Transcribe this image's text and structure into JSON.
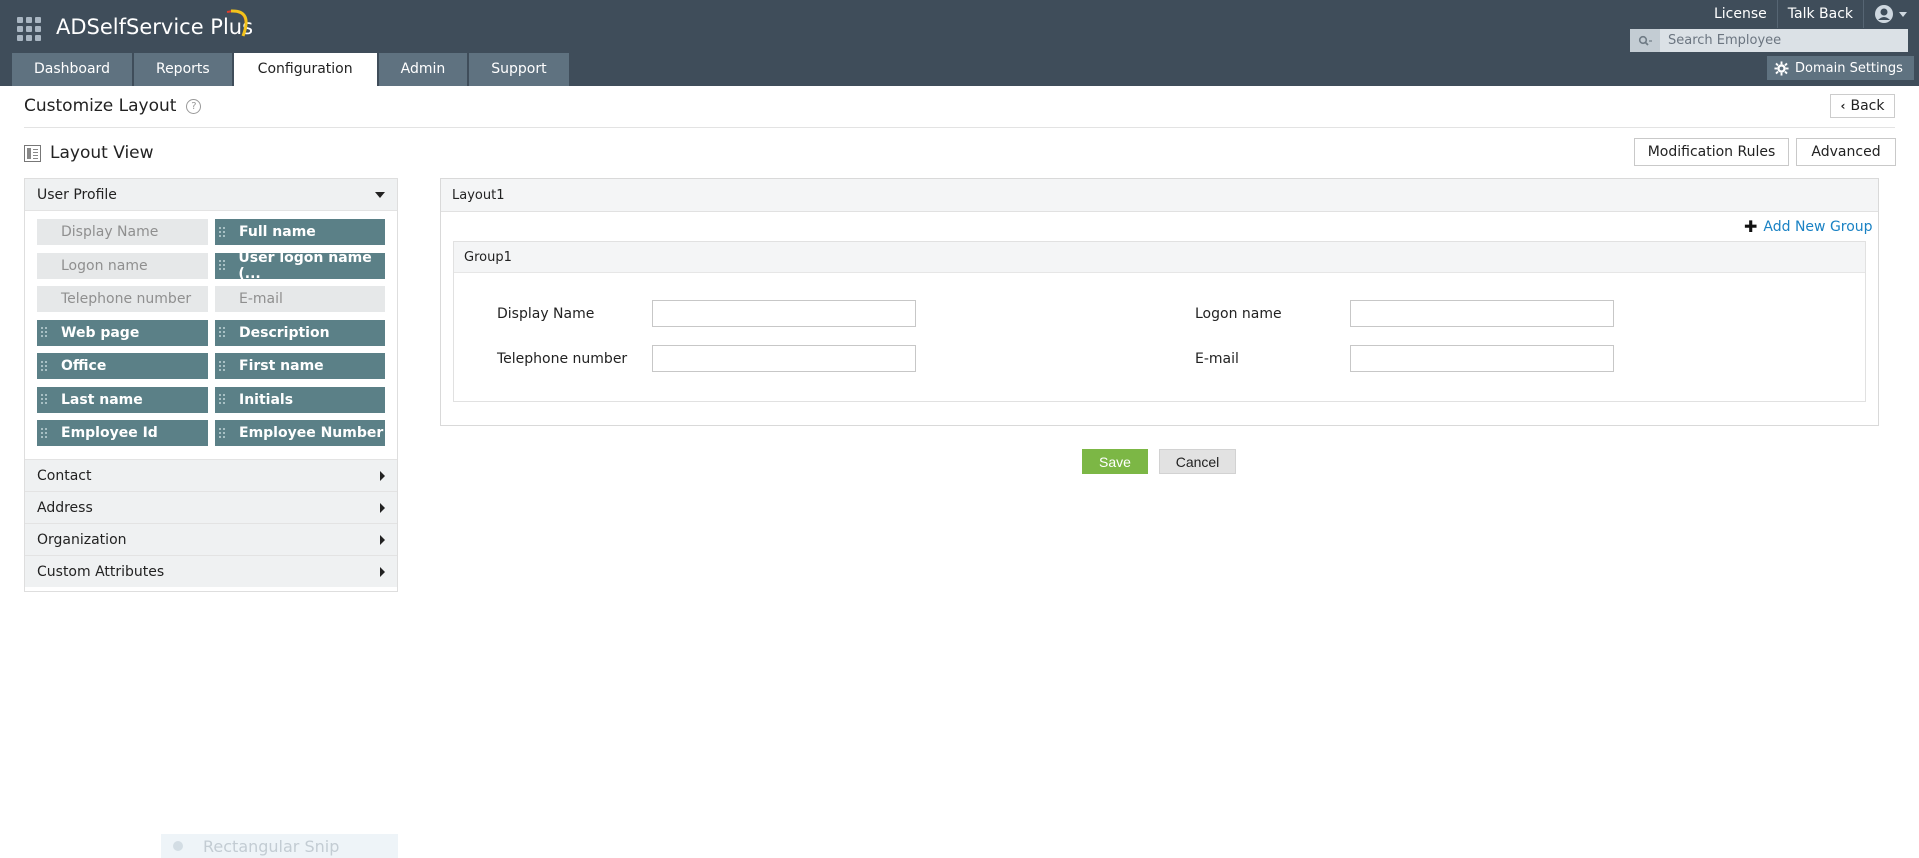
{
  "header": {
    "brand": "ADSelfService Plus",
    "links": [
      "License",
      "Talk Back"
    ],
    "search_placeholder": "Search Employee",
    "domain_settings": "Domain Settings"
  },
  "tabs": [
    {
      "label": "Dashboard",
      "active": false
    },
    {
      "label": "Reports",
      "active": false
    },
    {
      "label": "Configuration",
      "active": true
    },
    {
      "label": "Admin",
      "active": false
    },
    {
      "label": "Support",
      "active": false
    }
  ],
  "page": {
    "title": "Customize Layout",
    "help": "?",
    "back": "Back",
    "layout_view": "Layout View",
    "modification_rules": "Modification Rules",
    "advanced": "Advanced"
  },
  "panel": {
    "user_profile": "User Profile",
    "fields": [
      {
        "label": "Display Name",
        "state": "used"
      },
      {
        "label": "Full name",
        "state": "available"
      },
      {
        "label": "Logon name",
        "state": "used"
      },
      {
        "label": "User logon name (...",
        "state": "available"
      },
      {
        "label": "Telephone number",
        "state": "used"
      },
      {
        "label": "E-mail",
        "state": "used"
      },
      {
        "label": "Web page",
        "state": "available"
      },
      {
        "label": "Description",
        "state": "available"
      },
      {
        "label": "Office",
        "state": "available"
      },
      {
        "label": "First name",
        "state": "available"
      },
      {
        "label": "Last name",
        "state": "available"
      },
      {
        "label": "Initials",
        "state": "available"
      },
      {
        "label": "Employee Id",
        "state": "available"
      },
      {
        "label": "Employee Number",
        "state": "available"
      }
    ],
    "sections": [
      "Contact",
      "Address",
      "Organization",
      "Custom Attributes"
    ]
  },
  "layout": {
    "name": "Layout1",
    "add_group": "Add New Group",
    "group": {
      "name": "Group1",
      "fields": [
        "Display Name",
        "Logon name",
        "Telephone number",
        "E-mail"
      ]
    }
  },
  "actions": {
    "save": "Save",
    "cancel": "Cancel"
  },
  "overlay": {
    "snip_label": "Rectangular Snip"
  },
  "colors": {
    "header_bg": "#3f4d5a",
    "tab_bg": "#5f7280",
    "chip_available": "#5b8087",
    "chip_used": "#e6e8e9",
    "save": "#7cb745",
    "link": "#1a82c4"
  }
}
